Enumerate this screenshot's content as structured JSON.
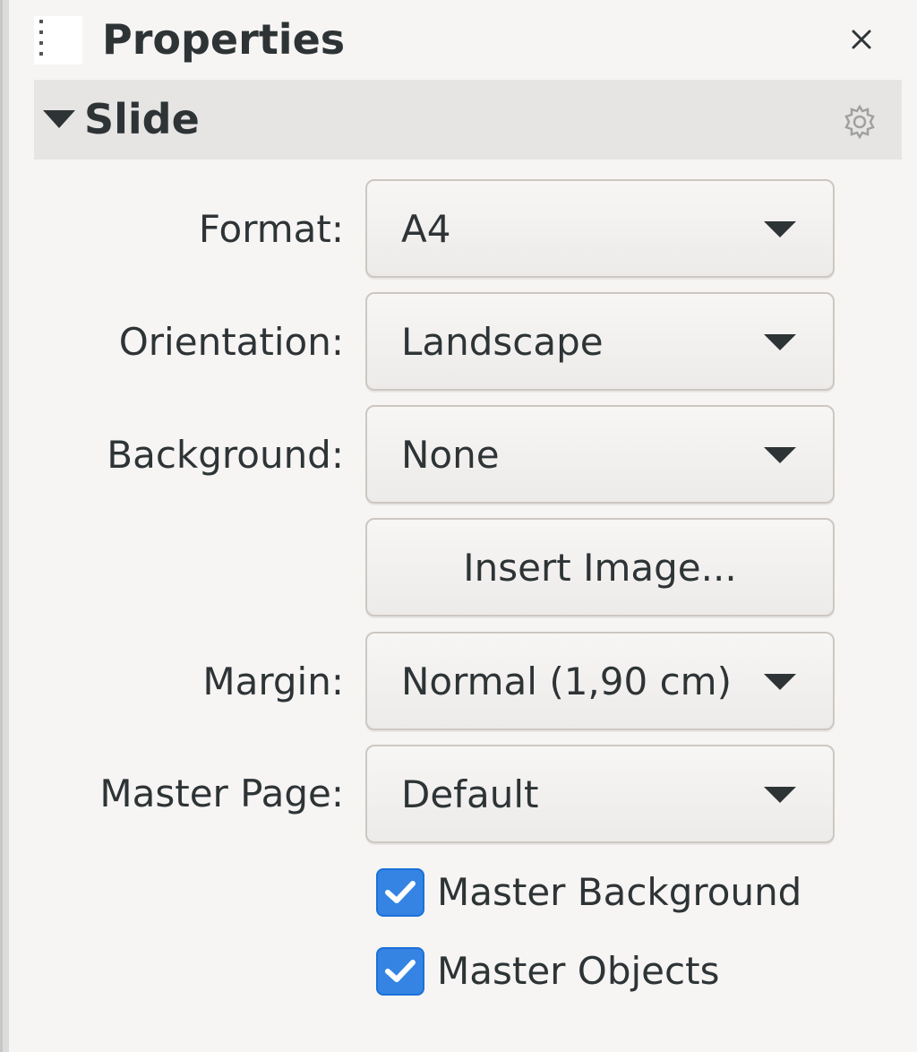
{
  "panel": {
    "title": "Properties",
    "close_icon": "close-icon",
    "grip_icon": "drag-handle-icon"
  },
  "section": {
    "title": "Slide",
    "expander_icon": "triangle-down-icon",
    "options_icon": "gear-icon"
  },
  "fields": {
    "format": {
      "label": "Format:",
      "value": "A4"
    },
    "orientation": {
      "label": "Orientation:",
      "value": "Landscape"
    },
    "background": {
      "label": "Background:",
      "value": "None"
    },
    "insert_image": {
      "label": "Insert Image..."
    },
    "margin": {
      "label": "Margin:",
      "value": "Normal (1,90 cm)"
    },
    "master_page": {
      "label": "Master Page:",
      "value": "Default"
    }
  },
  "checkboxes": {
    "master_background": {
      "label": "Master Background",
      "checked": true
    },
    "master_objects": {
      "label": "Master Objects",
      "checked": true
    }
  },
  "colors": {
    "accent": "#3584e4",
    "background": "#f6f5f4",
    "header": "#e6e5e4",
    "text": "#2e3436"
  }
}
